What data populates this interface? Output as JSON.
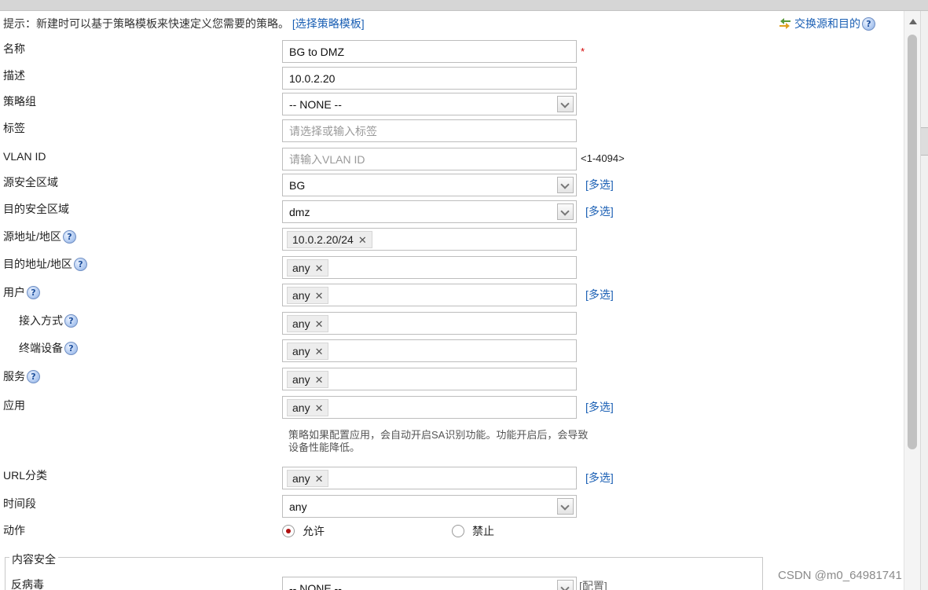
{
  "hint": {
    "text": "提示：新建时可以基于策略模板来快速定义您需要的策略。",
    "link": "[选择策略模板]"
  },
  "swap_link": "交换源和目的",
  "help_glyph": "?",
  "required_mark": "*",
  "fields": {
    "name": {
      "label": "名称",
      "value": "BG to DMZ"
    },
    "description": {
      "label": "描述",
      "value": "10.0.2.20"
    },
    "policy_group": {
      "label": "策略组",
      "value": "-- NONE --"
    },
    "tag": {
      "label": "标签",
      "placeholder": "请选择或输入标签"
    },
    "vlan": {
      "label": "VLAN ID",
      "placeholder": "请输入VLAN ID",
      "range": "<1-4094>"
    },
    "src_zone": {
      "label": "源安全区域",
      "value": "BG",
      "multi": "[多选]"
    },
    "dst_zone": {
      "label": "目的安全区域",
      "value": "dmz",
      "multi": "[多选]"
    },
    "src_addr": {
      "label": "源地址/地区",
      "tag": "10.0.2.20/24"
    },
    "dst_addr": {
      "label": "目的地址/地区",
      "tag": "any"
    },
    "user": {
      "label": "用户",
      "tag": "any",
      "multi": "[多选]"
    },
    "access_mode": {
      "label": "接入方式",
      "tag": "any"
    },
    "terminal": {
      "label": "终端设备",
      "tag": "any"
    },
    "service": {
      "label": "服务",
      "tag": "any"
    },
    "application": {
      "label": "应用",
      "tag": "any",
      "multi": "[多选]",
      "note": "策略如果配置应用，会自动开启SA识别功能。功能开启后，会导致设备性能降低。"
    },
    "url_category": {
      "label": "URL分类",
      "tag": "any",
      "multi": "[多选]"
    },
    "time_range": {
      "label": "时间段",
      "value": "any"
    },
    "action": {
      "label": "动作",
      "options": [
        "允许",
        "禁止"
      ],
      "selected": "允许"
    }
  },
  "content_security": {
    "legend": "内容安全",
    "antivirus": {
      "label": "反病毒",
      "value": "-- NONE --",
      "config": "[配置]"
    }
  },
  "watermark": "CSDN @m0_64981741",
  "tag_remove_glyph": "✕",
  "colors": {
    "link": "#1a5fb4",
    "required": "#d40000",
    "radio_selected": "#b01010"
  }
}
